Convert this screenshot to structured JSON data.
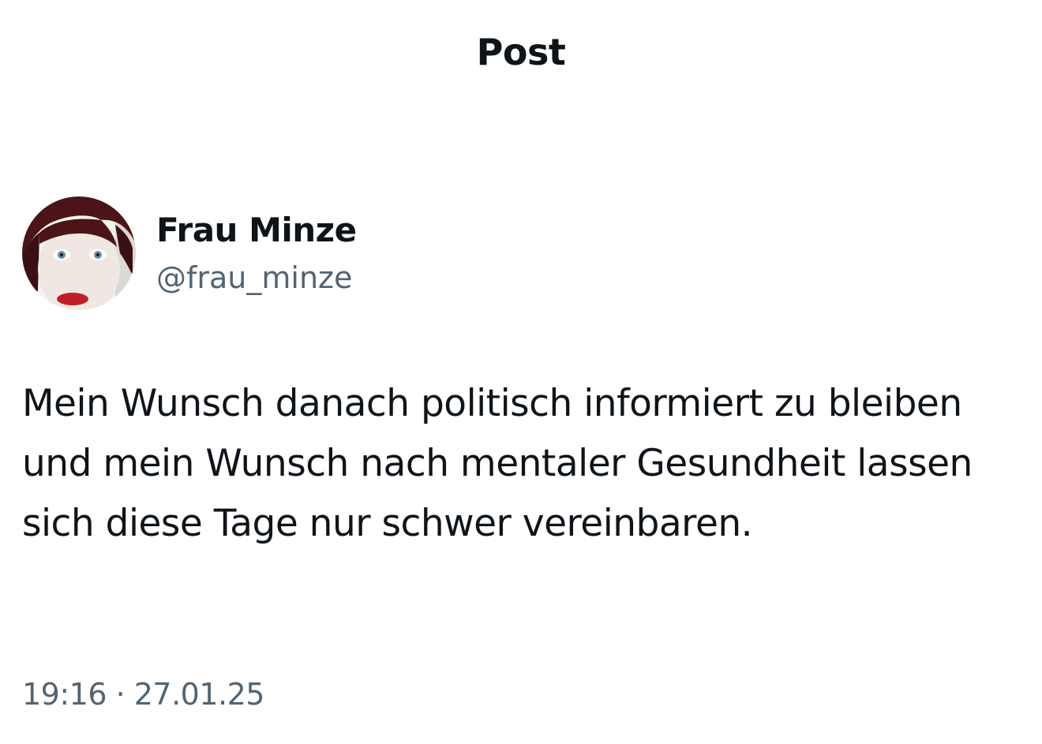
{
  "header": {
    "title": "Post"
  },
  "post": {
    "author": {
      "display_name": "Frau Minze",
      "handle": "@frau_minze"
    },
    "text": "Mein Wunsch danach politisch informiert zu bleiben und mein Wunsch nach mentaler Gesundheit lassen sich diese Tage nur schwer vereinbaren.",
    "timestamp": "19:16 · 27.01.25"
  },
  "colors": {
    "text_primary": "#0f1419",
    "text_secondary": "#536471",
    "background": "#ffffff"
  }
}
